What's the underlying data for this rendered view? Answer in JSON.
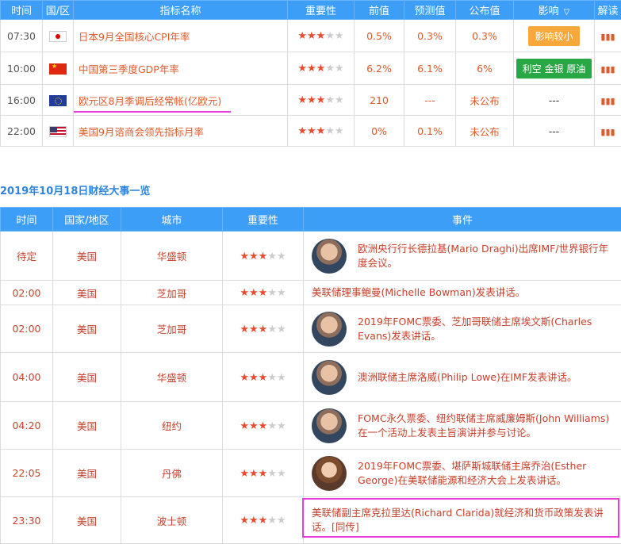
{
  "indicators": {
    "headers": [
      "时间",
      "国/区",
      "指标名称",
      "重要性",
      "前值",
      "预测值",
      "公布值",
      "影响",
      "解读"
    ],
    "rows": [
      {
        "time": "07:30",
        "flag": "flag-jp",
        "name": "日本9月全国核心CPI年率",
        "stars": 3,
        "prev": "0.5%",
        "forecast": "0.3%",
        "actual": "0.3%",
        "impact": "影响较小",
        "impact_color": "#f7a83a"
      },
      {
        "time": "10:00",
        "flag": "flag-cn",
        "name": "中国第三季度GDP年率",
        "stars": 3,
        "prev": "6.2%",
        "forecast": "6.1%",
        "actual": "6%",
        "impact": "利空 金银 原油",
        "impact_color": "#28a745"
      },
      {
        "time": "16:00",
        "flag": "flag-eu",
        "name": "欧元区8月季调后经常帐(亿欧元)",
        "stars": 3,
        "prev": "210",
        "forecast": "---",
        "actual": "未公布",
        "impact": "---",
        "impact_color": ""
      },
      {
        "time": "22:00",
        "flag": "flag-us",
        "name": "美国9月谘商会领先指标月率",
        "stars": 3,
        "prev": "0%",
        "forecast": "0.1%",
        "actual": "未公布",
        "impact": "---",
        "impact_color": ""
      }
    ]
  },
  "section_title": "2019年10月18日财经大事一览",
  "events": {
    "headers": [
      "时间",
      "国家/地区",
      "城市",
      "重要性",
      "事件"
    ],
    "rows": [
      {
        "time": "待定",
        "country": "美国",
        "city": "华盛顿",
        "stars": 3,
        "avatar": "m",
        "text": "欧洲央行行长德拉基(Mario Draghi)出席IMF/世界银行年度会议。"
      },
      {
        "time": "02:00",
        "country": "美国",
        "city": "芝加哥",
        "stars": 3,
        "avatar": "",
        "text": "美联储理事鲍曼(Michelle Bowman)发表讲话。"
      },
      {
        "time": "02:00",
        "country": "美国",
        "city": "芝加哥",
        "stars": 3,
        "avatar": "m",
        "text": "2019年FOMC票委、芝加哥联储主席埃文斯(Charles Evans)发表讲话。"
      },
      {
        "time": "04:00",
        "country": "美国",
        "city": "华盛顿",
        "stars": 3,
        "avatar": "m",
        "text": "澳洲联储主席洛威(Philip Lowe)在IMF发表讲话。"
      },
      {
        "time": "04:20",
        "country": "美国",
        "city": "纽约",
        "stars": 3,
        "avatar": "m",
        "text": "FOMC永久票委、纽约联储主席威廉姆斯(John Williams)在一个活动上发表主旨演讲并参与讨论。"
      },
      {
        "time": "22:05",
        "country": "美国",
        "city": "丹佛",
        "stars": 3,
        "avatar": "f",
        "text": "2019年FOMC票委、堪萨斯城联储主席乔治(Esther George)在美联储能源和经济大会上发表讲话。"
      },
      {
        "time": "23:30",
        "country": "美国",
        "city": "波士顿",
        "stars": 3,
        "avatar": "",
        "text": "美联储副主席克拉里达(Richard Clarida)就经济和货币政策发表讲话。[同传]"
      }
    ]
  },
  "icons": {
    "chart": "bar-chart-icon",
    "star": "star-icon",
    "chevron": "chevron-down-icon"
  }
}
